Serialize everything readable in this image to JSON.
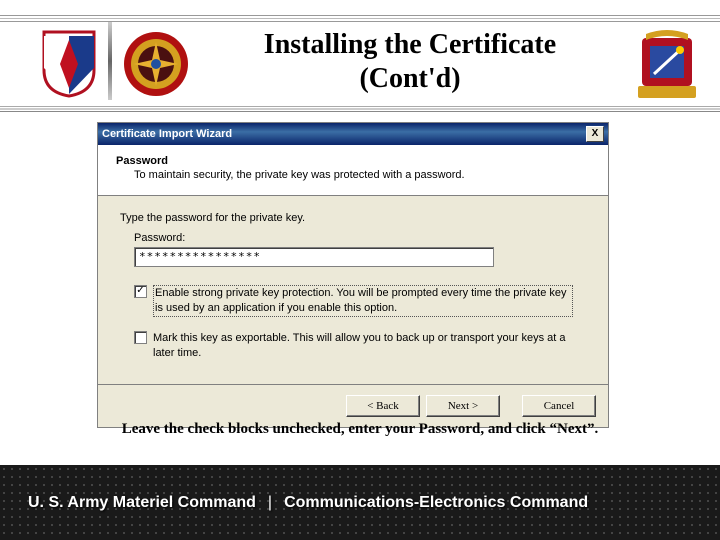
{
  "header": {
    "title": "Installing the Certificate (Cont'd)"
  },
  "wizard": {
    "window_title": "Certificate Import Wizard",
    "close_label": "X",
    "heading": "Password",
    "subheading": "To maintain security, the private key was protected with a password.",
    "prompt": "Type the password for the private key.",
    "password_label": "Password:",
    "password_value": "****************",
    "checkbox1": {
      "checked": "✓",
      "text": "Enable strong private key protection. You will be prompted every time the private key is used by an application if you enable this option."
    },
    "checkbox2": {
      "text": "Mark this key as exportable. This will allow you to back up or transport your keys at a later time."
    },
    "buttons": {
      "back": "< Back",
      "next": "Next >",
      "cancel": "Cancel"
    }
  },
  "caption": "Leave the check blocks unchecked, enter your Password, and click “Next”.",
  "footer": {
    "left": "U. S. Army Materiel Command",
    "sep": "|",
    "right": "Communications-Electronics Command"
  }
}
